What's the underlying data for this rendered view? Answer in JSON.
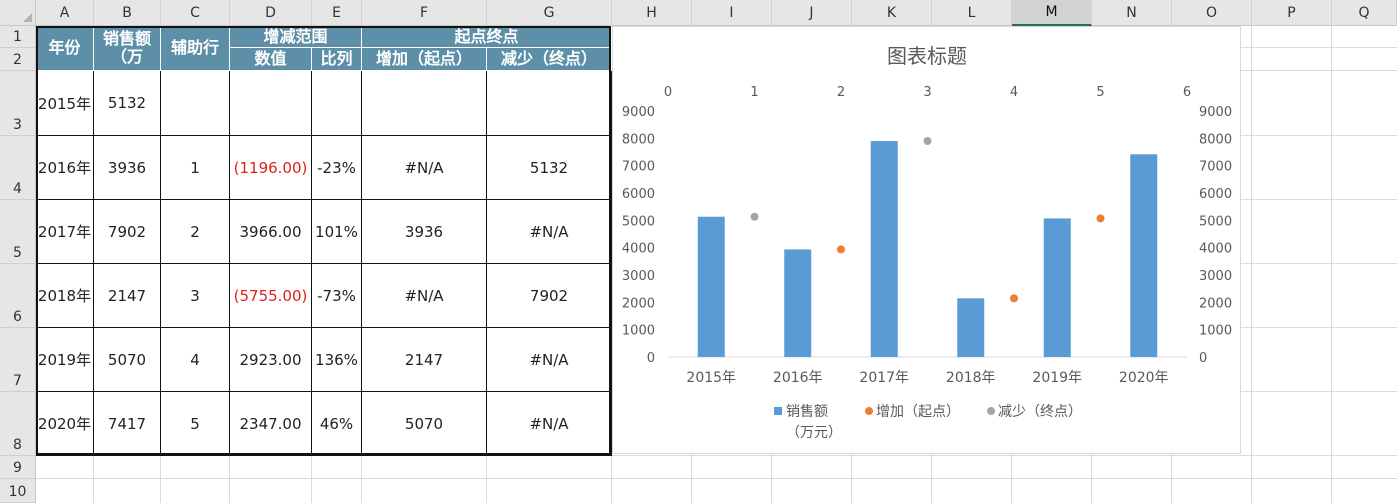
{
  "sheet": {
    "columns": [
      "A",
      "B",
      "C",
      "D",
      "E",
      "F",
      "G",
      "H",
      "I",
      "J",
      "K",
      "L",
      "M",
      "N",
      "O",
      "P",
      "Q"
    ],
    "selected_column": "M",
    "rows": [
      "1",
      "2",
      "3",
      "4",
      "5",
      "6",
      "7",
      "8",
      "9",
      "10"
    ]
  },
  "table": {
    "headers": {
      "year": "年份",
      "sales": "销售额\n（万",
      "helper": "辅助行",
      "range_group": "增减范围",
      "value": "数值",
      "ratio": "比列",
      "points_group": "起点终点",
      "increase": "增加（起点）",
      "decrease": "减少（终点）"
    },
    "rows": [
      {
        "year": "2015年",
        "sales": "5132",
        "helper": "",
        "value": "",
        "ratio": "",
        "increase": "",
        "decrease": "",
        "neg": false
      },
      {
        "year": "2016年",
        "sales": "3936",
        "helper": "1",
        "value": "(1196.00)",
        "ratio": "-23%",
        "increase": "#N/A",
        "decrease": "5132",
        "neg": true
      },
      {
        "year": "2017年",
        "sales": "7902",
        "helper": "2",
        "value": "3966.00",
        "ratio": "101%",
        "increase": "3936",
        "decrease": "#N/A",
        "neg": false
      },
      {
        "year": "2018年",
        "sales": "2147",
        "helper": "3",
        "value": "(5755.00)",
        "ratio": "-73%",
        "increase": "#N/A",
        "decrease": "7902",
        "neg": true
      },
      {
        "year": "2019年",
        "sales": "5070",
        "helper": "4",
        "value": "2923.00",
        "ratio": "136%",
        "increase": "2147",
        "decrease": "#N/A",
        "neg": false
      },
      {
        "year": "2020年",
        "sales": "7417",
        "helper": "5",
        "value": "2347.00",
        "ratio": "46%",
        "increase": "5070",
        "decrease": "#N/A",
        "neg": false
      }
    ]
  },
  "chart_data": {
    "type": "bar",
    "title": "图表标题",
    "categories": [
      "2015年",
      "2016年",
      "2017年",
      "2018年",
      "2019年",
      "2020年"
    ],
    "series": [
      {
        "name": "销售额（万元）",
        "type": "bar",
        "color": "#5b9bd5",
        "values": [
          5132,
          3936,
          7902,
          2147,
          5070,
          7417
        ]
      },
      {
        "name": "增加（起点）",
        "type": "scatter",
        "color": "#ed7d31",
        "points": [
          {
            "x": 2,
            "y": 3936
          },
          {
            "x": 4,
            "y": 2147
          },
          {
            "x": 5,
            "y": 5070
          }
        ]
      },
      {
        "name": "减少（终点）",
        "type": "scatter",
        "color": "#a5a5a5",
        "points": [
          {
            "x": 1,
            "y": 5132
          },
          {
            "x": 3,
            "y": 7902
          }
        ]
      }
    ],
    "ylim": [
      0,
      9000
    ],
    "yticks": [
      "0",
      "1000",
      "2000",
      "3000",
      "4000",
      "5000",
      "6000",
      "7000",
      "8000",
      "9000"
    ],
    "secondary_xlim": [
      0,
      6
    ],
    "secondary_xticks": [
      "0",
      "1",
      "2",
      "3",
      "4",
      "5",
      "6"
    ],
    "legend": {
      "bar": "销售额",
      "bar_wrap": "（万元）",
      "inc": "增加（起点）",
      "dec": "减少（终点）"
    },
    "legend_position": "bottom",
    "grid": false
  }
}
